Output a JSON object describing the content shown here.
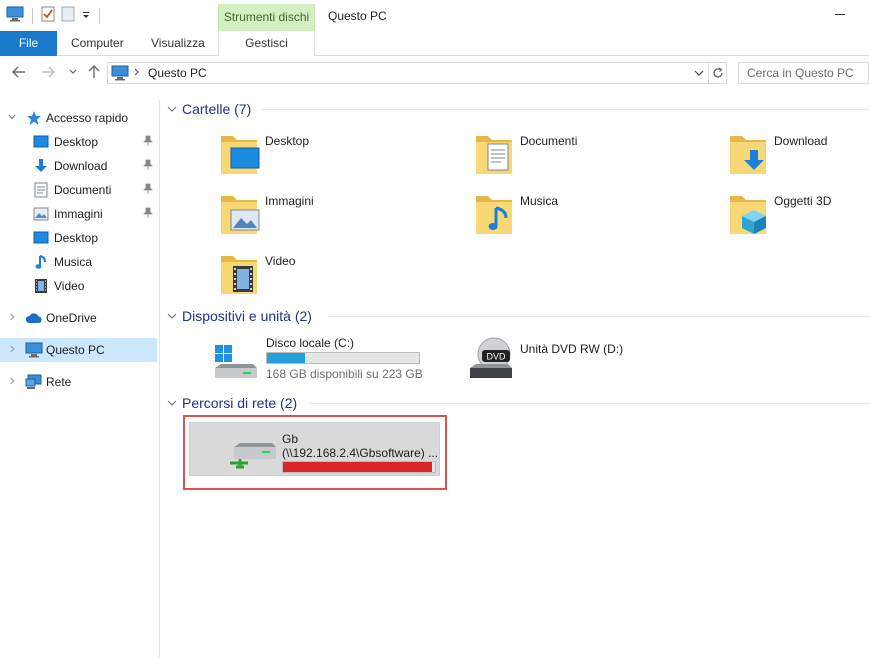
{
  "window": {
    "title": "Questo PC",
    "tools_tab": "Strumenti dischi"
  },
  "ribbon": {
    "file": "File",
    "computer": "Computer",
    "view": "Visualizza",
    "manage": "Gestisci"
  },
  "address": {
    "crumb": "Questo PC",
    "search_placeholder": "Cerca in Questo PC"
  },
  "sidebar": {
    "quick_access": "Accesso rapido",
    "quick_items": [
      {
        "label": "Desktop",
        "pinned": true
      },
      {
        "label": "Download",
        "pinned": true
      },
      {
        "label": "Documenti",
        "pinned": true
      },
      {
        "label": "Immagini",
        "pinned": true
      },
      {
        "label": "Desktop",
        "pinned": false
      },
      {
        "label": "Musica",
        "pinned": false
      },
      {
        "label": "Video",
        "pinned": false
      }
    ],
    "onedrive": "OneDrive",
    "this_pc": "Questo PC",
    "network": "Rete"
  },
  "groups": {
    "folders": {
      "title": "Cartelle (7)",
      "items": [
        "Desktop",
        "Documenti",
        "Download",
        "Immagini",
        "Musica",
        "Oggetti 3D",
        "Video"
      ]
    },
    "devices": {
      "title": "Dispositivi e unità (2)",
      "local": {
        "name": "Disco locale (C:)",
        "info": "168 GB disponibili su 223 GB",
        "used_fraction": 0.25
      },
      "dvd": {
        "name": "Unità DVD RW (D:)",
        "badge": "DVD"
      }
    },
    "network": {
      "title": "Percorsi di rete (2)",
      "item": {
        "name": "Gb",
        "path": "(\\\\192.168.2.4\\Gbsoftware) ...",
        "used_fraction": 0.98
      }
    }
  },
  "colors": {
    "accent": "#1979ca",
    "selection": "#cce8ff",
    "group_title": "#1e3287",
    "disk_bar": "#26a0da",
    "disk_full": "#da2626",
    "highlight_frame": "#d9534f",
    "folder": "#f8d775"
  }
}
